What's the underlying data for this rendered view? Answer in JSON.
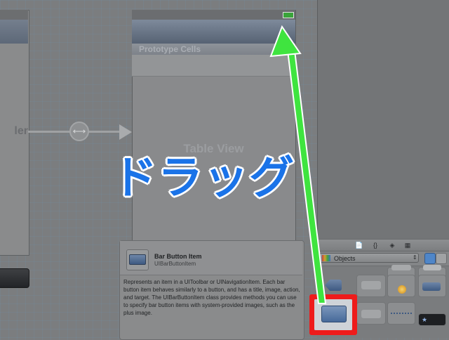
{
  "left_scene": {
    "label": "ler"
  },
  "segue": {
    "icon": "segue-link-icon",
    "glyph": "⟷"
  },
  "table_scene": {
    "section_title": "Prototype Cells",
    "table_label": "Table View",
    "battery_icon": "battery-icon"
  },
  "library": {
    "tabs": [
      "📄",
      "{}",
      "◈",
      "▦"
    ],
    "dropdown_label": "Objects",
    "dropdown_arrows": "⇕",
    "icon_view": "icon-view-icon",
    "list_view": "list-view-icon"
  },
  "popover": {
    "title": "Bar Button Item",
    "subtitle": "UIBarButtonItem",
    "description": "Represents an item in a UIToolbar or UINavigationItem. Each bar button item behaves similarly to a button, and has a title, image, action, and target. The UIBarButtonItem class provides methods you can use to specify bar button items with system-provided images, such as the plus image."
  },
  "annotation": {
    "caption": "ドラッグ",
    "arrow_color": "#3fe43f",
    "highlight_color": "#ee1b1b",
    "caption_color": "#1a73e8"
  }
}
